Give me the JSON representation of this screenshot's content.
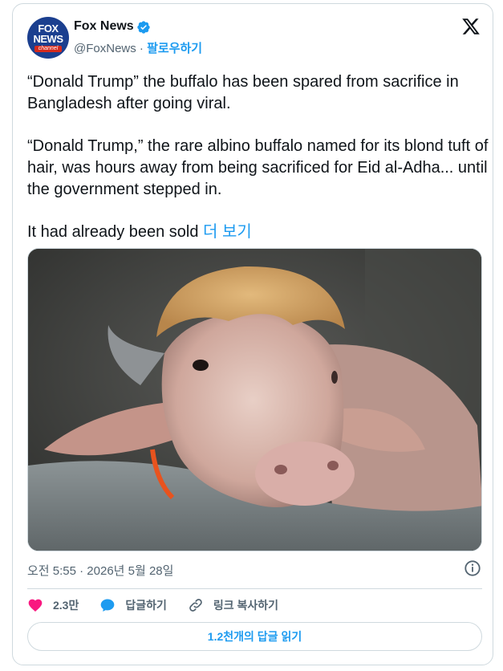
{
  "author": {
    "name": "Fox News",
    "handle": "@FoxNews",
    "separator": " · ",
    "follow_label": "팔로우하기",
    "avatar_logo_text": "FOX NEWS",
    "avatar_channel_text": "channel"
  },
  "tweet": {
    "paragraphs": [
      "“Donald Trump” the buffalo has been spared from sacrifice in Bangladesh after going viral.",
      "“Donald Trump,” the rare albino buffalo named for its blond tuft of hair, was hours away from being sacrificed for Eid al-Adha... until the government stepped in."
    ],
    "truncated_text": "It had already been sold ",
    "more_label": "더 보기",
    "timestamp": "오전 5:55 · 2026년 5월 28일"
  },
  "actions": {
    "likes": "2.3만",
    "reply_label": "답글하기",
    "copy_link_label": "링크 복사하기"
  },
  "replies_button_label": "1.2천개의 답글 읽기",
  "icons": {
    "platform": "x-logo-icon",
    "verified": "verified-badge-icon",
    "info": "info-icon",
    "like": "heart-icon",
    "reply": "speech-bubble-icon",
    "copy_link": "link-icon"
  },
  "colors": {
    "accent": "#1d9bf0",
    "like": "#f91880",
    "text": "#0f1419",
    "secondary_text": "#536471",
    "border": "#cfd9de",
    "avatar_bg": "#1b3f8f"
  }
}
